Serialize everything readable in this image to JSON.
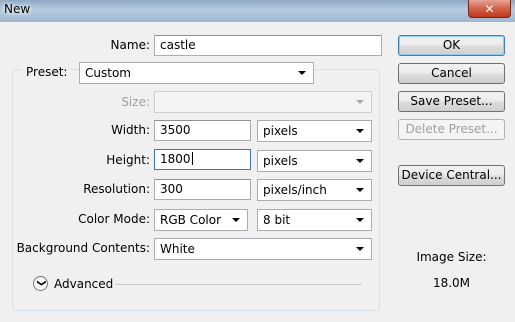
{
  "window": {
    "title": "New",
    "close_glyph": "✕"
  },
  "name": {
    "label": "Name:",
    "value": "castle"
  },
  "preset": {
    "label": "Preset:",
    "value": "Custom"
  },
  "size": {
    "label": "Size:",
    "value": ""
  },
  "width": {
    "label": "Width:",
    "value": "3500",
    "unit": "pixels"
  },
  "height": {
    "label": "Height:",
    "value": "1800",
    "unit": "pixels"
  },
  "resolution": {
    "label": "Resolution:",
    "value": "300",
    "unit": "pixels/inch"
  },
  "color_mode": {
    "label": "Color Mode:",
    "mode": "RGB Color",
    "depth": "8 bit"
  },
  "background": {
    "label": "Background Contents:",
    "value": "White"
  },
  "advanced": {
    "label": "Advanced",
    "glyph": "❯"
  },
  "buttons": {
    "ok": "OK",
    "cancel": "Cancel",
    "save_preset": "Save Preset...",
    "delete_preset": "Delete Preset...",
    "device_central": "Device Central..."
  },
  "image_size": {
    "label": "Image Size:",
    "value": "18.0M"
  }
}
